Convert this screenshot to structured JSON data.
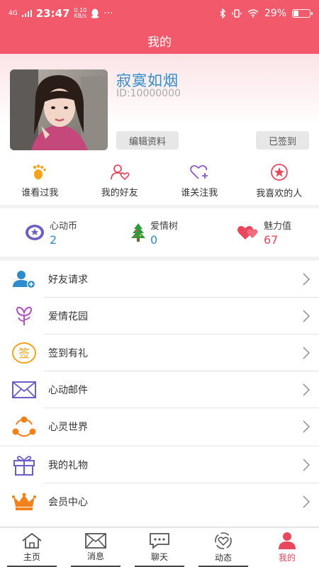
{
  "status": {
    "net": "4G",
    "time": "23:47",
    "speed_value": "0.10",
    "speed_unit": "KB/s",
    "more": "···",
    "battery_percent": "29%",
    "battery_level": 0.29
  },
  "header": {
    "title": "我的"
  },
  "profile": {
    "nickname": "寂寞如烟",
    "user_id": "ID:10000000",
    "edit_label": "编辑资料",
    "signed_label": "已签到"
  },
  "quick_links": [
    {
      "label": "谁看过我",
      "icon": "footprint-icon"
    },
    {
      "label": "我的好友",
      "icon": "friend-heart-icon"
    },
    {
      "label": "谁关注我",
      "icon": "heart-plus-icon"
    },
    {
      "label": "我喜欢的人",
      "icon": "star-circle-icon"
    }
  ],
  "stats": [
    {
      "label": "心动币",
      "value": "2",
      "icon": "coin-icon"
    },
    {
      "label": "爱情树",
      "value": "0",
      "icon": "tree-icon"
    },
    {
      "label": "魅力值",
      "value": "67",
      "icon": "hearts-icon"
    }
  ],
  "menu": [
    {
      "label": "好友请求",
      "icon": "add-user-icon"
    },
    {
      "label": "爱情花园",
      "icon": "flower-icon"
    },
    {
      "label": "签到有礼",
      "icon": "sign-in-icon",
      "icon_text": "签"
    },
    {
      "label": "心动邮件",
      "icon": "mail-icon"
    },
    {
      "label": "心灵世界",
      "icon": "network-icon"
    }
  ],
  "menu2": [
    {
      "label": "我的礼物",
      "icon": "gift-icon"
    },
    {
      "label": "会员中心",
      "icon": "crown-icon"
    }
  ],
  "tabs": [
    {
      "label": "主页",
      "icon": "home-icon"
    },
    {
      "label": "消息",
      "icon": "envelope-icon"
    },
    {
      "label": "聊天",
      "icon": "chat-icon"
    },
    {
      "label": "动态",
      "icon": "moments-icon"
    },
    {
      "label": "我的",
      "icon": "profile-icon",
      "active": true
    }
  ],
  "colors": {
    "brand": "#f25a6b",
    "accent_blue": "#2f8ccc",
    "accent_red": "#e8475c"
  }
}
